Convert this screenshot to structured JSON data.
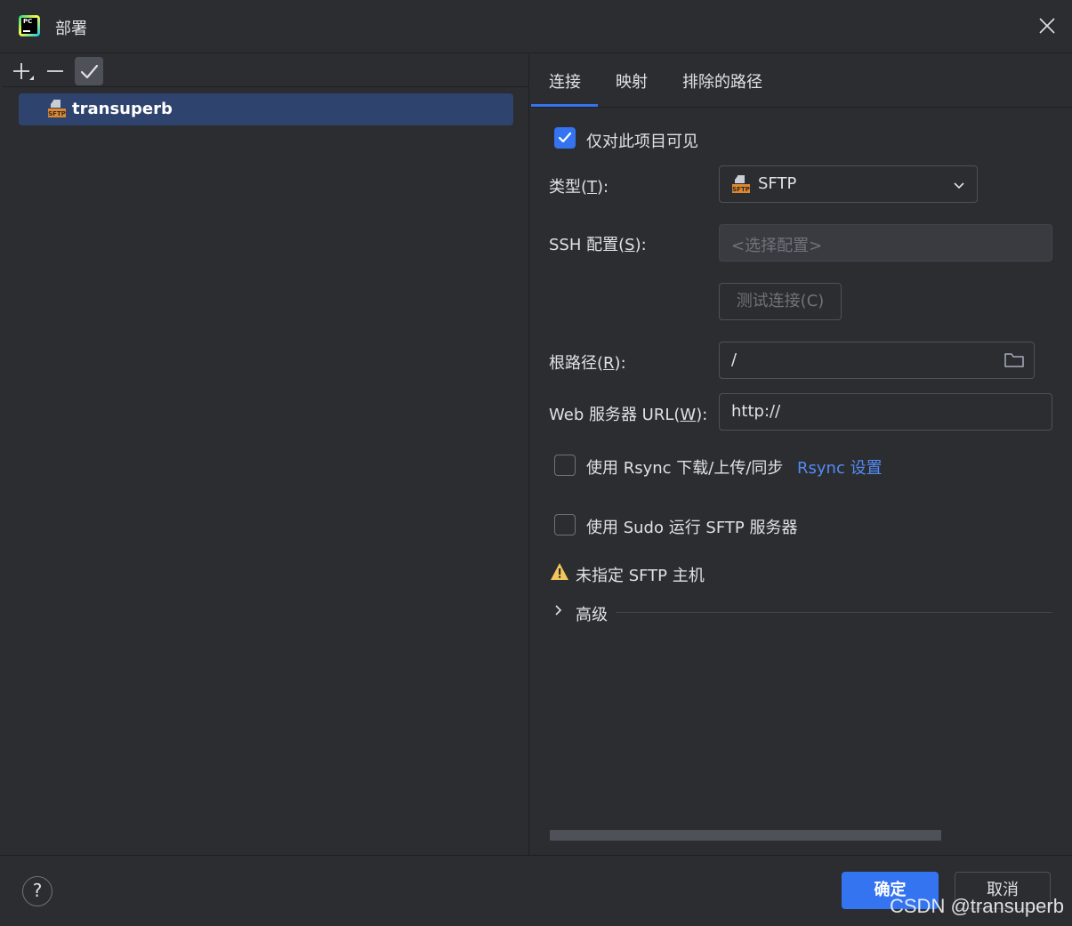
{
  "window": {
    "title": "部署",
    "app_icon": "pycharm-logo",
    "app_icon_text": "PC"
  },
  "sidebar": {
    "toolbar": {
      "add_icon": "plus-icon",
      "remove_icon": "minus-icon",
      "default_icon": "checkmark-icon"
    },
    "servers": [
      {
        "name": "transuperb",
        "icon": "sftp-icon",
        "icon_text": "SFTP",
        "selected": true
      }
    ]
  },
  "tabs": [
    {
      "label": "连接",
      "active": true
    },
    {
      "label": "映射",
      "active": false
    },
    {
      "label": "排除的路径",
      "active": false
    }
  ],
  "form": {
    "visible_only_project": {
      "label": "仅对此项目可见",
      "checked": true
    },
    "type": {
      "label_pre": "类型(",
      "mnemonic": "T",
      "label_post": "):",
      "value": "SFTP"
    },
    "ssh_config": {
      "label_pre": "SSH 配置(",
      "mnemonic": "S",
      "label_post": "):",
      "placeholder": "<选择配置>"
    },
    "test_connection": {
      "label": "测试连接(C)"
    },
    "root_path": {
      "label_pre": "根路径(",
      "mnemonic": "R",
      "label_post": "):",
      "value": "/"
    },
    "web_url": {
      "label_pre": "Web 服务器 URL(",
      "mnemonic": "W",
      "label_post": "):",
      "value": "http://"
    },
    "rsync": {
      "label": "使用 Rsync 下载/上传/同步",
      "checked": false,
      "link": "Rsync 设置"
    },
    "sudo": {
      "label": "使用 Sudo 运行 SFTP 服务器",
      "checked": false
    },
    "warning": {
      "text": "未指定 SFTP 主机",
      "icon": "warning-icon"
    },
    "advanced": {
      "label": "高级",
      "expanded": false
    }
  },
  "footer": {
    "help": "?",
    "ok": "确定",
    "cancel": "取消",
    "watermark": "CSDN @transuperb"
  },
  "colors": {
    "accent": "#3574f0",
    "link": "#548af7",
    "selection": "#2e436e",
    "background": "#2b2d30",
    "warning": "#f2c55c"
  }
}
